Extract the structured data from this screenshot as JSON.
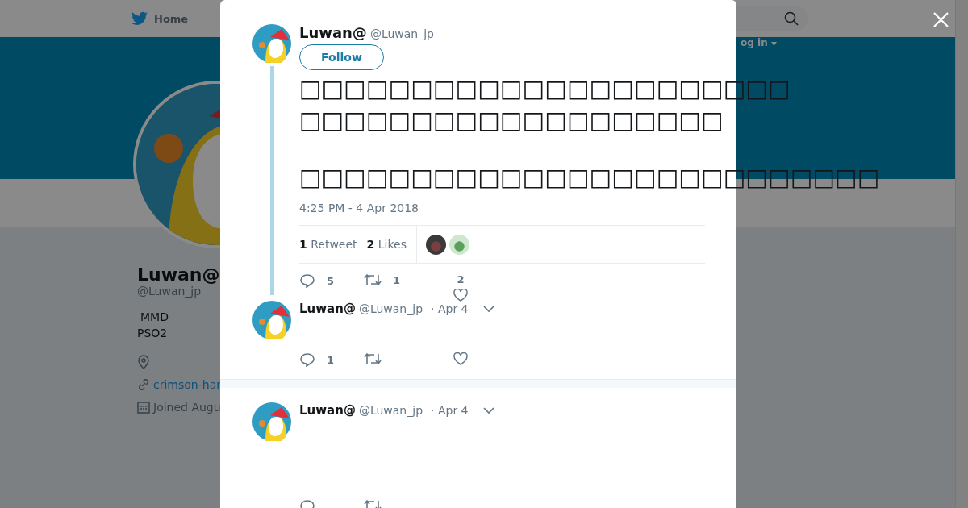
{
  "nav": {
    "home": "Home",
    "login": "og in"
  },
  "profile": {
    "name": "Luwan@",
    "handle": "@Luwan_jp",
    "bio": [
      "MMD",
      "PSO2"
    ],
    "link": "crimson-har",
    "joined": "Joined Augu"
  },
  "tweet": {
    "name": "Luwan@",
    "handle": "@Luwan_jp",
    "follow": "Follow",
    "paragraphs": [
      [
        "□□□□□□□□□□□□□□□□□□□□□□",
        "□□□□□□□□□□□□□□□□□□□"
      ],
      [
        "□□□□□□□□□□□□□□□□□□□□□□□□□□"
      ]
    ],
    "time": "4:25 PM - 4 Apr 2018",
    "stats": [
      {
        "count": "1",
        "label": "Retweet"
      },
      {
        "count": "2",
        "label": "Likes"
      }
    ],
    "actions": {
      "replies": "5",
      "retweets": "1",
      "likes": "2"
    }
  },
  "replies": [
    {
      "name": "Luwan@",
      "handle": "@Luwan_jp",
      "date": "· Apr 4",
      "actions": {
        "replies": "1"
      }
    },
    {
      "name": "Luwan@",
      "handle": "@Luwan_jp",
      "date": "· Apr 4"
    }
  ]
}
